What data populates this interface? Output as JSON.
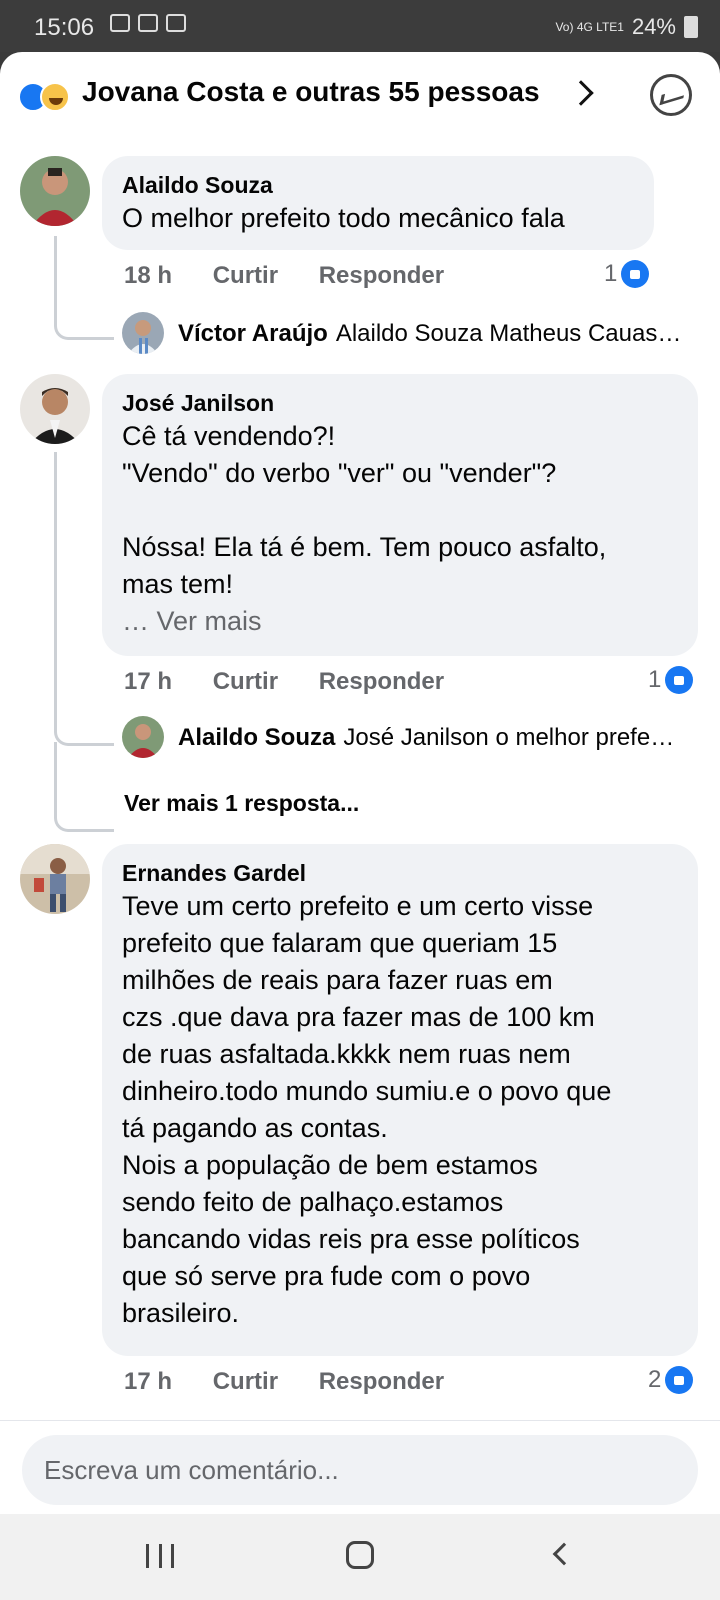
{
  "statusbar": {
    "time": "15:06",
    "signal_text": "Vo) 4G LTE1",
    "battery": "24%"
  },
  "header": {
    "title": "Jovana Costa e outras 55 pessoas"
  },
  "comments": [
    {
      "author": "Alaildo Souza",
      "text": "O melhor prefeito todo mecânico fala",
      "time": "18 h",
      "like_label": "Curtir",
      "reply_label": "Responder",
      "likes": "1",
      "reply": {
        "author": "Víctor Araújo",
        "text": "Alaildo Souza Matheus Cauas…"
      }
    },
    {
      "author": "José Janilson",
      "text": "Cê tá vendendo?!\n\"Vendo\" do verbo \"ver\" ou \"vender\"?\n\nNóssa! Ela tá é bem. Tem pouco asfalto,\nmas tem!",
      "see_more": "… Ver mais",
      "time": "17 h",
      "like_label": "Curtir",
      "reply_label": "Responder",
      "likes": "1",
      "reply": {
        "author": "Alaildo Souza",
        "text": "José Janilson o melhor prefe…"
      },
      "more_replies": "Ver mais 1 resposta..."
    },
    {
      "author": "Ernandes Gardel",
      "text": "Teve um certo prefeito e um certo visse\nprefeito que falaram que queriam 15\nmilhões de reais para fazer ruas em\nczs .que dava pra fazer mas de 100 km\nde ruas asfaltada.kkkk nem ruas nem\ndinheiro.todo mundo sumiu.e o povo que\ntá pagando as contas.\nNois a população de bem estamos\nsendo feito de palhaço.estamos\nbancando vidas reis pra esse políticos\nque só serve pra fude com o povo\nbrasileiro.",
      "time": "17 h",
      "like_label": "Curtir",
      "reply_label": "Responder",
      "likes": "2"
    }
  ],
  "input": {
    "placeholder": "Escreva um comentário..."
  },
  "colors": {
    "accent": "#1877f2",
    "bubble": "#f0f2f5",
    "meta": "#65676b"
  }
}
